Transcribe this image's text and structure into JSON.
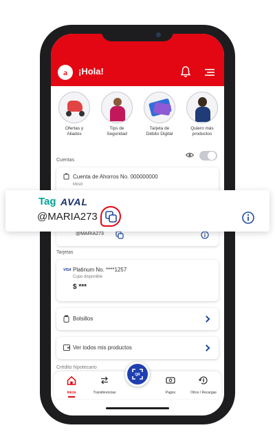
{
  "header": {
    "greeting": "¡Hola!",
    "logo_letter": "a"
  },
  "quick_actions": [
    {
      "label_line1": "Ofertas y",
      "label_line2": "Aliados"
    },
    {
      "label_line1": "Tips de",
      "label_line2": "Seguridad"
    },
    {
      "label_line1": "Tarjeta de",
      "label_line2": "Débito Digital"
    },
    {
      "label_line1": "Quiero más",
      "label_line2": "productos"
    }
  ],
  "sections": {
    "accounts": "Cuentas",
    "cards": "Tarjetas",
    "mortgage": "Crédito hipotecario"
  },
  "account": {
    "title": "Cuenta de Ahorros No. 000000000",
    "subtitle": "Movil"
  },
  "tag_aval": {
    "prefix": "Tag",
    "brand": "AVAL",
    "handle": "@MARIA273"
  },
  "tag_row_handle": "@MARIA273",
  "card": {
    "brand": "VISA",
    "title": "Platinum No. ****1257",
    "subtitle": "Cupo disponible",
    "amount": "$ ***"
  },
  "bolsillos": "Bolsillos",
  "all_products": "Ver todos mis productos",
  "nav": {
    "home": "Inicio",
    "transfer": "Transferencias",
    "qr": "QR",
    "payments": "Pagos",
    "other": "Otros / Recargas"
  },
  "colors": {
    "brand_red": "#e30613",
    "accent_blue": "#1f3fb0",
    "aval_green": "#00a39a"
  }
}
